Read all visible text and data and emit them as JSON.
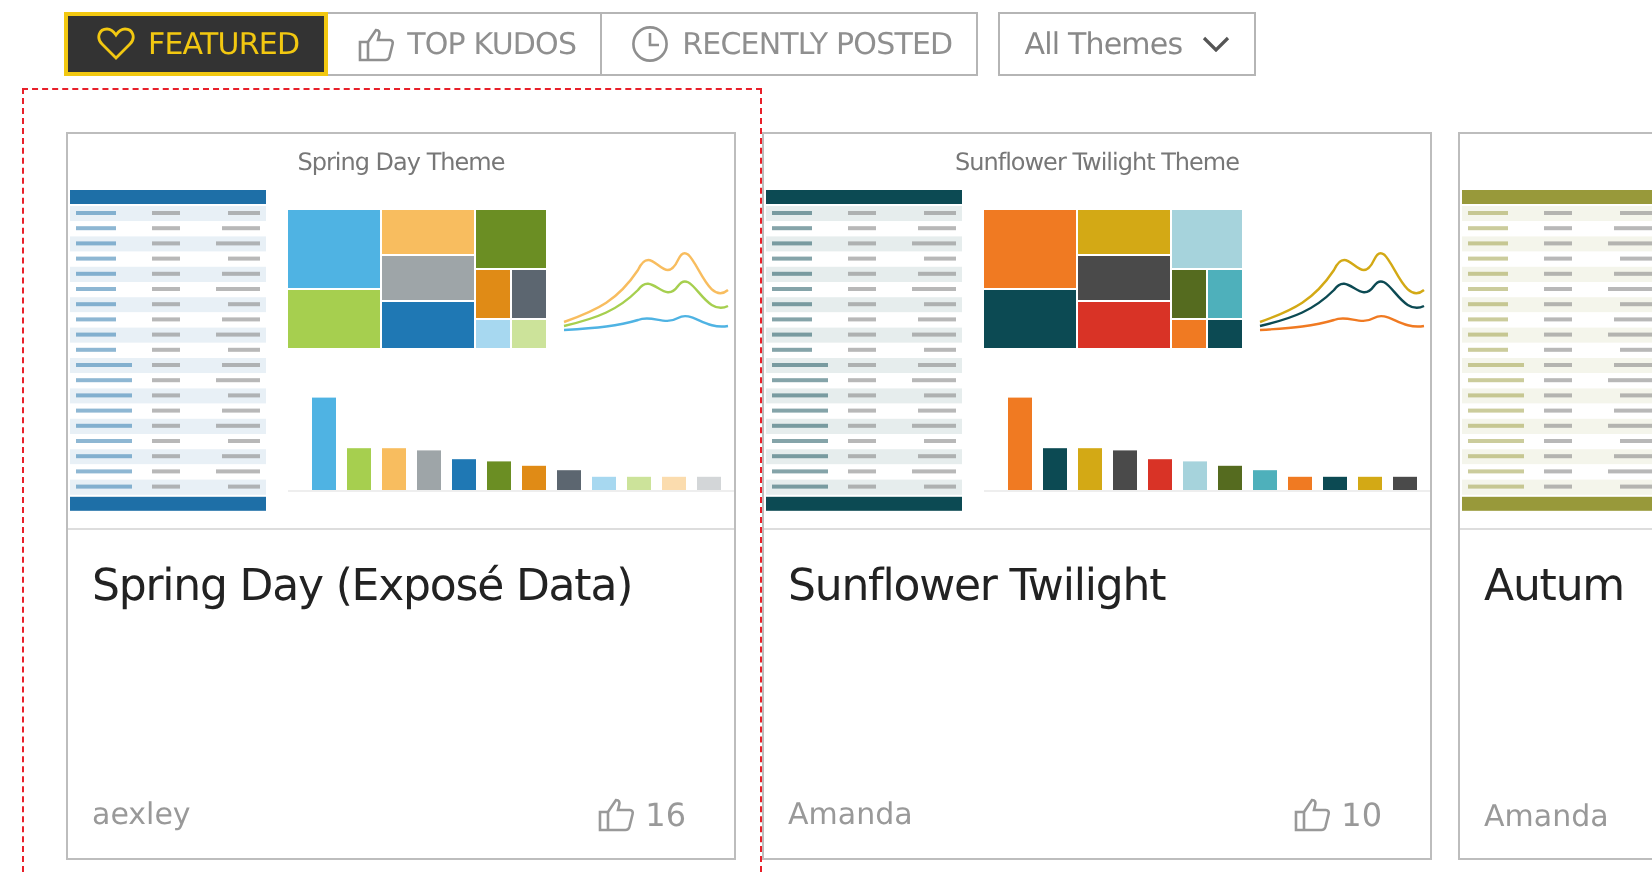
{
  "tabs": [
    {
      "label": "FEATURED",
      "selected": true
    },
    {
      "label": "TOP KUDOS",
      "selected": false
    },
    {
      "label": "RECENTLY POSTED",
      "selected": false
    }
  ],
  "theme_filter": {
    "value": "All Themes"
  },
  "cards": [
    {
      "preview_title": "Spring Day Theme",
      "title": "Spring Day (Exposé Data)",
      "author": "aexley",
      "kudos": "16",
      "selected": true
    },
    {
      "preview_title": "Sunflower Twilight Theme",
      "title": "Sunflower Twilight",
      "author": "Amanda",
      "kudos": "10",
      "selected": false
    },
    {
      "title": "Autum",
      "author": "Amanda",
      "selected": false
    }
  ]
}
